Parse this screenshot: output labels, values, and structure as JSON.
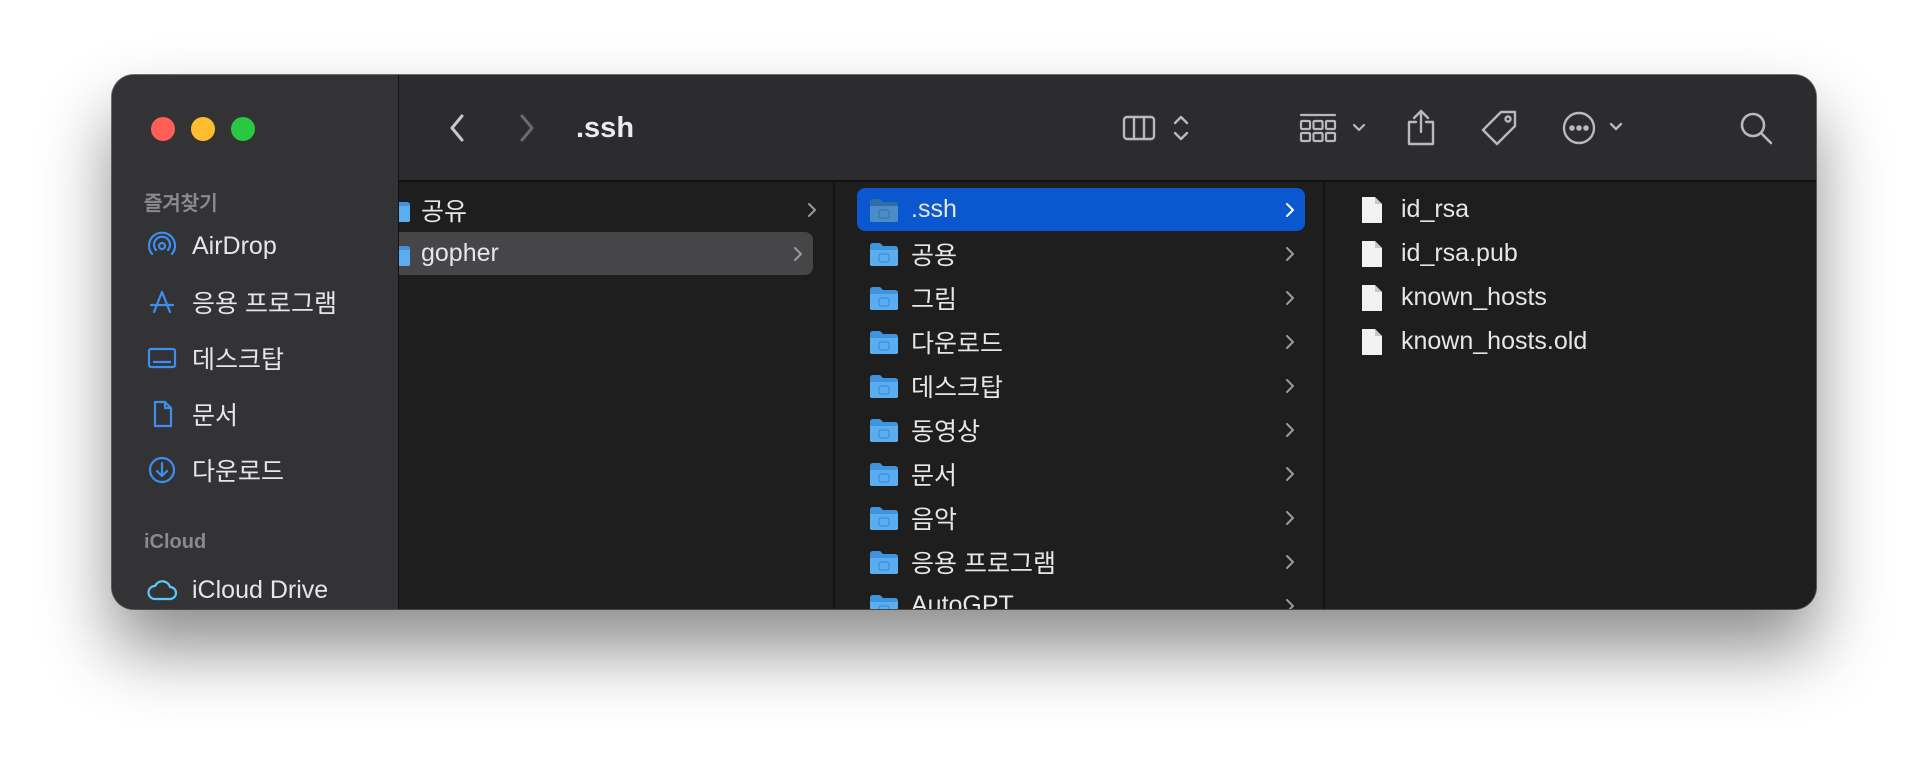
{
  "window": {
    "title": ".ssh"
  },
  "sidebar": {
    "favorites_header": "즐겨찾기",
    "favorites": [
      {
        "label": "AirDrop",
        "icon": "airdrop-icon"
      },
      {
        "label": "응용 프로그램",
        "icon": "applications-icon"
      },
      {
        "label": "데스크탑",
        "icon": "desktop-icon"
      },
      {
        "label": "문서",
        "icon": "document-icon"
      },
      {
        "label": "다운로드",
        "icon": "download-icon"
      }
    ],
    "icloud_header": "iCloud",
    "icloud": [
      {
        "label": "iCloud Drive",
        "icon": "cloud-icon"
      }
    ]
  },
  "toolbar": {
    "back_icon": "chevron-left-icon",
    "forward_icon": "chevron-right-icon",
    "view_icon": "column-view-icon",
    "group_icon": "grid-group-icon",
    "share_icon": "share-icon",
    "tag_icon": "tag-icon",
    "more_icon": "ellipsis-circle-icon",
    "search_icon": "search-icon"
  },
  "columns": {
    "col1": [
      {
        "label": "공유",
        "selected": false
      },
      {
        "label": "gopher",
        "selected": true
      }
    ],
    "col2": [
      {
        "label": ".ssh",
        "selected": true
      },
      {
        "label": "공용"
      },
      {
        "label": "그림"
      },
      {
        "label": "다운로드"
      },
      {
        "label": "데스크탑"
      },
      {
        "label": "동영상"
      },
      {
        "label": "문서"
      },
      {
        "label": "음악"
      },
      {
        "label": "응용 프로그램"
      },
      {
        "label": "AutoGPT"
      }
    ],
    "col3": [
      {
        "label": "id_rsa"
      },
      {
        "label": "id_rsa.pub"
      },
      {
        "label": "known_hosts"
      },
      {
        "label": "known_hosts.old"
      }
    ]
  },
  "colors": {
    "accent": "#0b57d0",
    "sidebar_icon": "#3d8ef0",
    "folder": "#5aaef0"
  }
}
